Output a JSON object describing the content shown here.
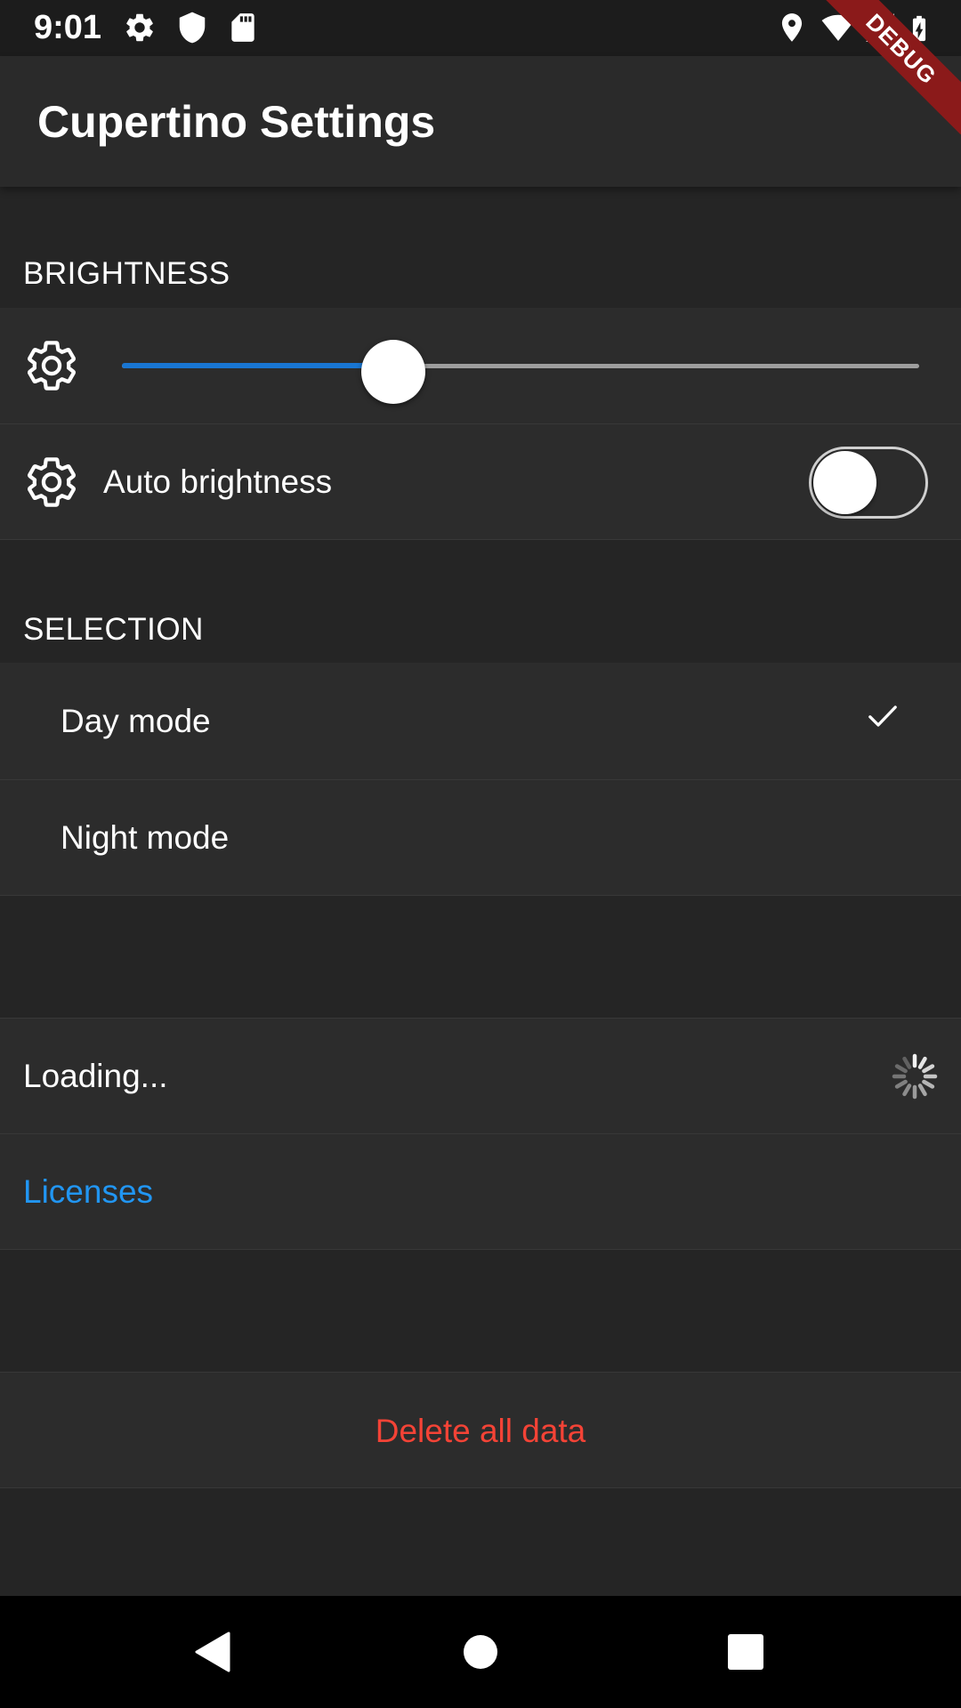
{
  "status_bar": {
    "time": "9:01",
    "left_icons": [
      "gear-icon",
      "shield-icon",
      "sd-card-icon"
    ],
    "right_icons": [
      "location-icon",
      "wifi-icon",
      "signal-icon",
      "battery-charging-icon"
    ]
  },
  "debug_banner": "DEBUG",
  "app_bar": {
    "title": "Cupertino Settings"
  },
  "brightness": {
    "header": "BRIGHTNESS",
    "slider_value": 0.34,
    "auto_label": "Auto brightness",
    "auto_enabled": false
  },
  "selection": {
    "header": "SELECTION",
    "options": [
      {
        "label": "Day mode",
        "selected": true
      },
      {
        "label": "Night mode",
        "selected": false
      }
    ]
  },
  "misc": {
    "loading_label": "Loading...",
    "licenses_label": "Licenses"
  },
  "danger": {
    "delete_label": "Delete all data"
  },
  "colors": {
    "accent": "#1976d2",
    "link": "#2196f3",
    "destructive": "#f44336",
    "background": "#252525",
    "row": "#2c2c2c"
  },
  "nav_bar": {
    "icons": [
      "back-icon",
      "home-icon",
      "recents-icon"
    ]
  }
}
